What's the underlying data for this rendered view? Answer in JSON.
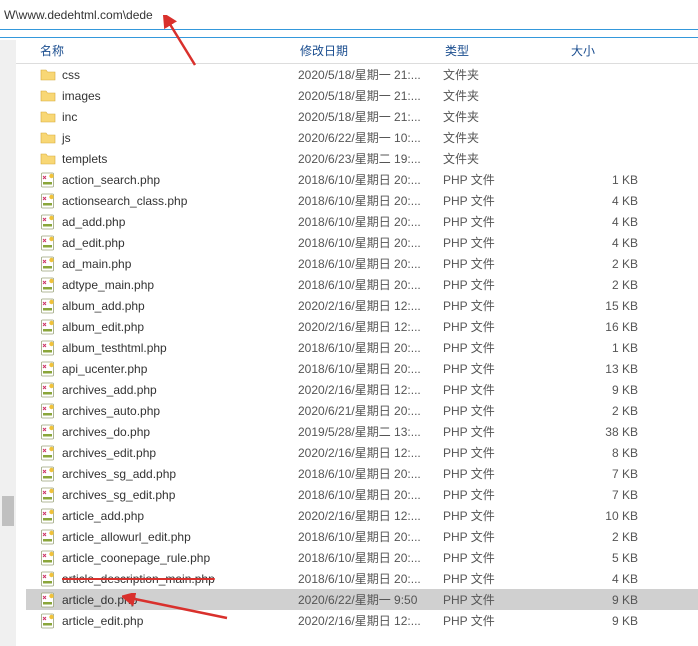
{
  "path": "W\\www.dedehtml.com\\dede",
  "headers": {
    "name": "名称",
    "date": "修改日期",
    "type": "类型",
    "size": "大小"
  },
  "folder_type": "文件夹",
  "php_type": "PHP 文件",
  "rows": [
    {
      "kind": "folder",
      "name": "css",
      "date": "2020/5/18/星期一 21:...",
      "type": "文件夹",
      "size": ""
    },
    {
      "kind": "folder",
      "name": "images",
      "date": "2020/5/18/星期一 21:...",
      "type": "文件夹",
      "size": ""
    },
    {
      "kind": "folder",
      "name": "inc",
      "date": "2020/5/18/星期一 21:...",
      "type": "文件夹",
      "size": ""
    },
    {
      "kind": "folder",
      "name": "js",
      "date": "2020/6/22/星期一 10:...",
      "type": "文件夹",
      "size": ""
    },
    {
      "kind": "folder",
      "name": "templets",
      "date": "2020/6/23/星期二 19:...",
      "type": "文件夹",
      "size": ""
    },
    {
      "kind": "php",
      "name": "action_search.php",
      "date": "2018/6/10/星期日 20:...",
      "type": "PHP 文件",
      "size": "1 KB"
    },
    {
      "kind": "php",
      "name": "actionsearch_class.php",
      "date": "2018/6/10/星期日 20:...",
      "type": "PHP 文件",
      "size": "4 KB"
    },
    {
      "kind": "php",
      "name": "ad_add.php",
      "date": "2018/6/10/星期日 20:...",
      "type": "PHP 文件",
      "size": "4 KB"
    },
    {
      "kind": "php",
      "name": "ad_edit.php",
      "date": "2018/6/10/星期日 20:...",
      "type": "PHP 文件",
      "size": "4 KB"
    },
    {
      "kind": "php",
      "name": "ad_main.php",
      "date": "2018/6/10/星期日 20:...",
      "type": "PHP 文件",
      "size": "2 KB"
    },
    {
      "kind": "php",
      "name": "adtype_main.php",
      "date": "2018/6/10/星期日 20:...",
      "type": "PHP 文件",
      "size": "2 KB"
    },
    {
      "kind": "php",
      "name": "album_add.php",
      "date": "2020/2/16/星期日 12:...",
      "type": "PHP 文件",
      "size": "15 KB"
    },
    {
      "kind": "php",
      "name": "album_edit.php",
      "date": "2020/2/16/星期日 12:...",
      "type": "PHP 文件",
      "size": "16 KB"
    },
    {
      "kind": "php",
      "name": "album_testhtml.php",
      "date": "2018/6/10/星期日 20:...",
      "type": "PHP 文件",
      "size": "1 KB"
    },
    {
      "kind": "php",
      "name": "api_ucenter.php",
      "date": "2018/6/10/星期日 20:...",
      "type": "PHP 文件",
      "size": "13 KB"
    },
    {
      "kind": "php",
      "name": "archives_add.php",
      "date": "2020/2/16/星期日 12:...",
      "type": "PHP 文件",
      "size": "9 KB"
    },
    {
      "kind": "php",
      "name": "archives_auto.php",
      "date": "2020/6/21/星期日 20:...",
      "type": "PHP 文件",
      "size": "2 KB"
    },
    {
      "kind": "php",
      "name": "archives_do.php",
      "date": "2019/5/28/星期二 13:...",
      "type": "PHP 文件",
      "size": "38 KB"
    },
    {
      "kind": "php",
      "name": "archives_edit.php",
      "date": "2020/2/16/星期日 12:...",
      "type": "PHP 文件",
      "size": "8 KB"
    },
    {
      "kind": "php",
      "name": "archives_sg_add.php",
      "date": "2018/6/10/星期日 20:...",
      "type": "PHP 文件",
      "size": "7 KB"
    },
    {
      "kind": "php",
      "name": "archives_sg_edit.php",
      "date": "2018/6/10/星期日 20:...",
      "type": "PHP 文件",
      "size": "7 KB"
    },
    {
      "kind": "php",
      "name": "article_add.php",
      "date": "2020/2/16/星期日 12:...",
      "type": "PHP 文件",
      "size": "10 KB"
    },
    {
      "kind": "php",
      "name": "article_allowurl_edit.php",
      "date": "2018/6/10/星期日 20:...",
      "type": "PHP 文件",
      "size": "2 KB"
    },
    {
      "kind": "php",
      "name": "article_coonepage_rule.php",
      "date": "2018/6/10/星期日 20:...",
      "type": "PHP 文件",
      "size": "5 KB"
    },
    {
      "kind": "php",
      "name": "article_description_main.php",
      "date": "2018/6/10/星期日 20:...",
      "type": "PHP 文件",
      "size": "4 KB",
      "strike": true
    },
    {
      "kind": "php",
      "name": "article_do.php",
      "date": "2020/6/22/星期一 9:50",
      "type": "PHP 文件",
      "size": "9 KB",
      "selected": true
    },
    {
      "kind": "php",
      "name": "article_edit.php",
      "date": "2020/2/16/星期日 12:...",
      "type": "PHP 文件",
      "size": "9 KB"
    }
  ]
}
